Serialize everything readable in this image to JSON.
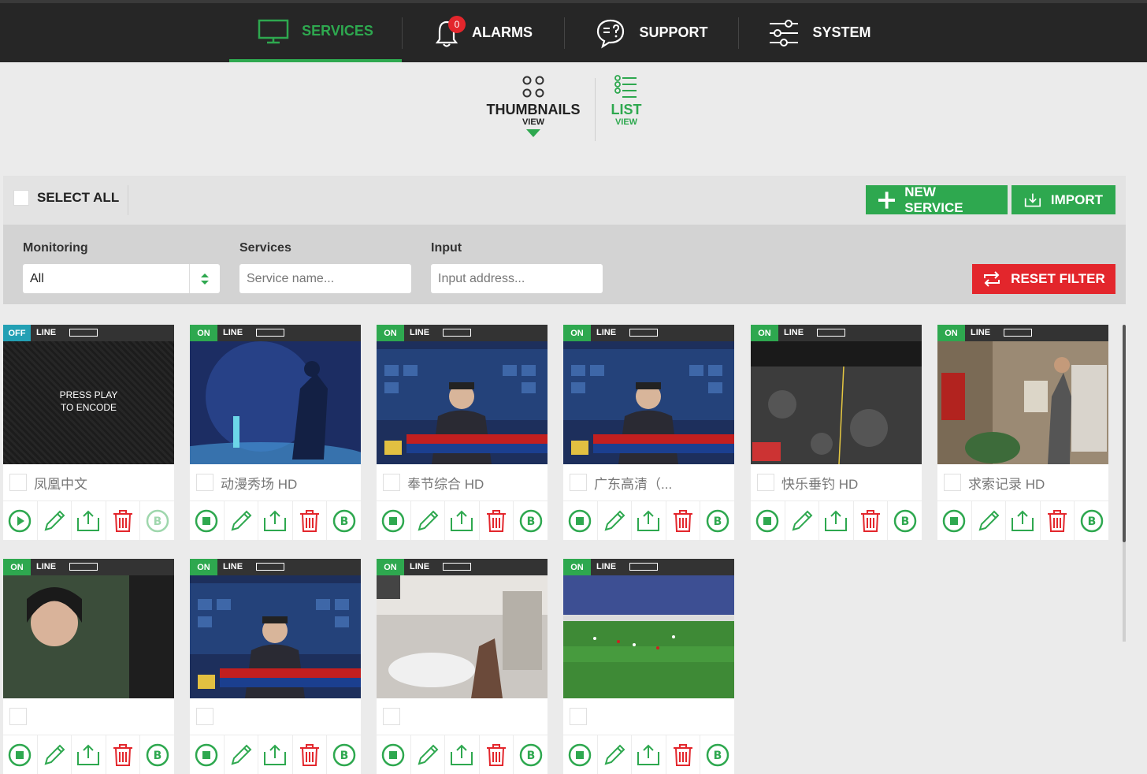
{
  "nav": {
    "services": "SERVICES",
    "alarms": "ALARMS",
    "alarms_count": "0",
    "support": "SUPPORT",
    "system": "SYSTEM"
  },
  "view": {
    "thumbnails": "THUMBNAILS",
    "thumbnails_sub": "VIEW",
    "list": "LIST",
    "list_sub": "VIEW"
  },
  "toolbar": {
    "select_all": "SELECT ALL",
    "new_service": "NEW SERVICE",
    "import": "IMPORT"
  },
  "filters": {
    "monitoring_label": "Monitoring",
    "monitoring_value": "All",
    "services_label": "Services",
    "services_placeholder": "Service name...",
    "input_label": "Input",
    "input_placeholder": "Input address...",
    "reset": "RESET FILTER"
  },
  "line_label": "LINE",
  "press_play": [
    "PRESS PLAY",
    "TO ENCODE"
  ],
  "services": [
    {
      "status": "OFF",
      "name": "凤凰中文"
    },
    {
      "status": "ON",
      "name": "动漫秀场 HD"
    },
    {
      "status": "ON",
      "name": "奉节综合 HD"
    },
    {
      "status": "ON",
      "name": "广东高清（..."
    },
    {
      "status": "ON",
      "name": "快乐垂钓 HD"
    },
    {
      "status": "ON",
      "name": "求索记录 HD"
    },
    {
      "status": "ON",
      "name": ""
    },
    {
      "status": "ON",
      "name": ""
    },
    {
      "status": "ON",
      "name": ""
    },
    {
      "status": "ON",
      "name": ""
    }
  ],
  "colors": {
    "accent_green": "#2ea84f",
    "danger_red": "#e3262c",
    "off_teal": "#23a0b4",
    "nav_bg": "#262626"
  }
}
